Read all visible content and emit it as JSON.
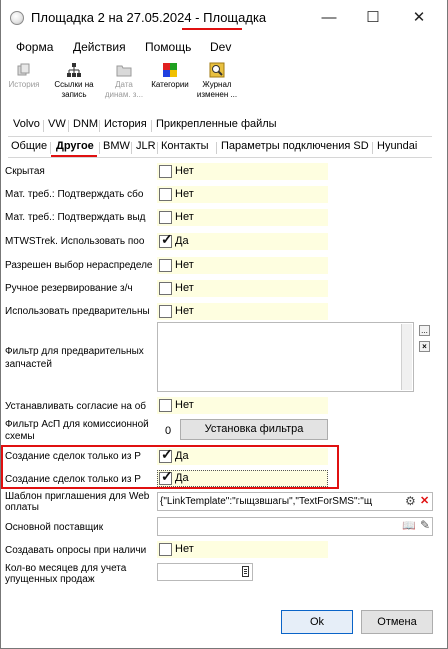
{
  "window": {
    "title_prefix": "Площадка 2 на 27.05.2024 - ",
    "title_suffix": "Площадка",
    "minimize": "—",
    "maximize": "☐",
    "close": "✕"
  },
  "menu": {
    "items": [
      "Форма",
      "Действия",
      "Помощь",
      "Dev"
    ]
  },
  "toolbar": {
    "history": {
      "line1": "История",
      "line2": ""
    },
    "links": {
      "line1": "Ссылки на",
      "line2": "запись"
    },
    "date": {
      "line1": "Дата",
      "line2": "динам. з..."
    },
    "categories": {
      "line1": "Категории",
      "line2": ""
    },
    "journal": {
      "line1": "Журнал",
      "line2": "изменен ..."
    }
  },
  "tabs": {
    "row1": [
      "Volvo",
      "VW",
      "DNM",
      "История",
      "Прикрепленные файлы"
    ],
    "row2": [
      "Общие",
      "Другое",
      "BMW",
      "JLR",
      "Контакты",
      "Параметры подключения SD",
      "Hyundai"
    ]
  },
  "fields": {
    "hidden": {
      "label": "Скрытая",
      "value": "Нет"
    },
    "mat_confirm_1": {
      "label": "Мат. треб.: Подтверждать сбо",
      "value": "Нет"
    },
    "mat_confirm_2": {
      "label": "Мат. треб.: Подтверждать выд",
      "value": "Нет"
    },
    "mtws": {
      "label": "MTWSTrek. Использовать поо",
      "value": "Да"
    },
    "allow_unassigned": {
      "label": "Разрешен выбор нераспределе",
      "value": "Нет"
    },
    "manual_reserve": {
      "label": "Ручное резервирование з/ч",
      "value": "Нет"
    },
    "use_preliminary": {
      "label": "Использовать предварительны",
      "value": "Нет"
    },
    "parts_filter": {
      "label": "Фильтр для предварительных запчастей",
      "more_btn": "...",
      "clear_btn": "×"
    },
    "set_consent": {
      "label": "Устанавливать согласие на об",
      "value": "Нет"
    },
    "asp_filter": {
      "label": "Фильтр АсП для комиссионной схемы",
      "count": "0",
      "button": "Установка фильтра"
    },
    "create_deals_1": {
      "label": "Создание сделок только из Р",
      "value": "Да"
    },
    "create_deals_2": {
      "label": "Создание сделок только из Р",
      "value": "Да"
    },
    "web_template": {
      "label": "Шаблон приглашения для Web оплаты",
      "value": "{\"LinkTemplate\":\"гыщзвшагы\",\"TextForSMS\":\"щ"
    },
    "main_supplier": {
      "label": "Основной поставщик",
      "value": ""
    },
    "create_polls": {
      "label": "Создавать опросы при наличи",
      "value": "Нет"
    },
    "months_count": {
      "label": "Кол-во месяцев для учета упущенных продаж",
      "value": ""
    }
  },
  "footer": {
    "ok": "Ok",
    "cancel": "Отмена"
  },
  "colors": {
    "accent_red": "#e01010",
    "field_yellow": "#fefee0"
  }
}
